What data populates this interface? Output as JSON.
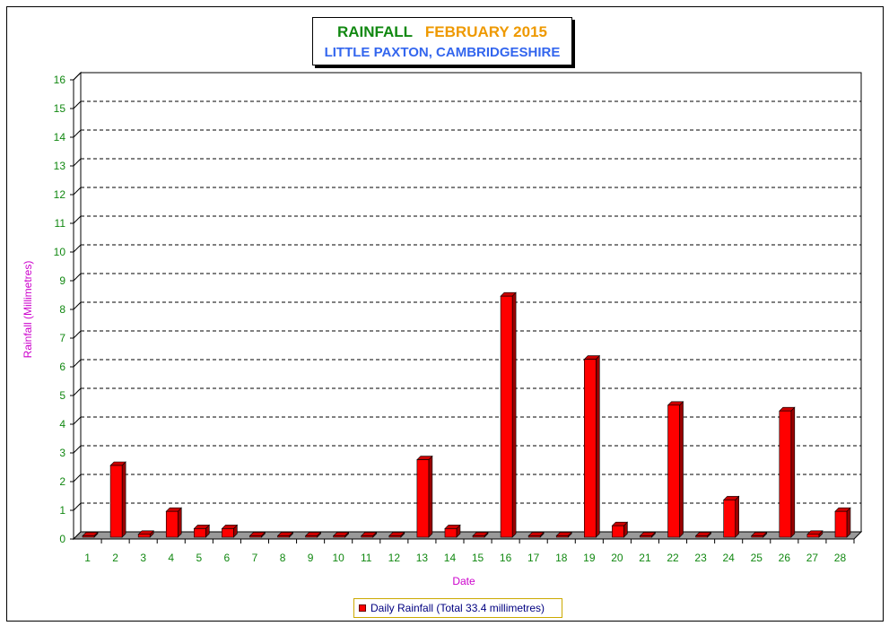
{
  "title": {
    "line1_part1": "RAINFALL",
    "line1_part2": "FEBRUARY 2015",
    "line2": "LITTLE PAXTON, CAMBRIDGESHIRE"
  },
  "legend_label": "Daily Rainfall (Total 33.4 millimetres)",
  "colors": {
    "bar": "#ff0000",
    "bar_side": "#990000",
    "axis_text": "#118811",
    "axis_title": "#cc00cc"
  },
  "chart_data": {
    "type": "bar",
    "title": "RAINFALL   FEBRUARY 2015",
    "subtitle": "LITTLE PAXTON, CAMBRIDGESHIRE",
    "xlabel": "Date",
    "ylabel": "Rainfall  (Millimetres)",
    "ylim": [
      0,
      16
    ],
    "yticks": [
      0,
      1,
      2,
      3,
      4,
      5,
      6,
      7,
      8,
      9,
      10,
      11,
      12,
      13,
      14,
      15,
      16
    ],
    "grid": true,
    "legend_position": "bottom",
    "categories": [
      "1",
      "2",
      "3",
      "4",
      "5",
      "6",
      "7",
      "8",
      "9",
      "10",
      "11",
      "12",
      "13",
      "14",
      "15",
      "16",
      "17",
      "18",
      "19",
      "20",
      "21",
      "22",
      "23",
      "24",
      "25",
      "26",
      "27",
      "28"
    ],
    "series": [
      {
        "name": "Daily Rainfall (Total 33.4 millimetres)",
        "values": [
          0,
          2.5,
          0.1,
          0.9,
          0.3,
          0.3,
          0,
          0,
          0,
          0,
          0,
          0,
          2.7,
          0.3,
          0,
          8.4,
          0,
          0,
          6.2,
          0.4,
          0,
          4.6,
          0,
          1.3,
          0,
          4.4,
          0.1,
          0.9
        ]
      }
    ]
  }
}
